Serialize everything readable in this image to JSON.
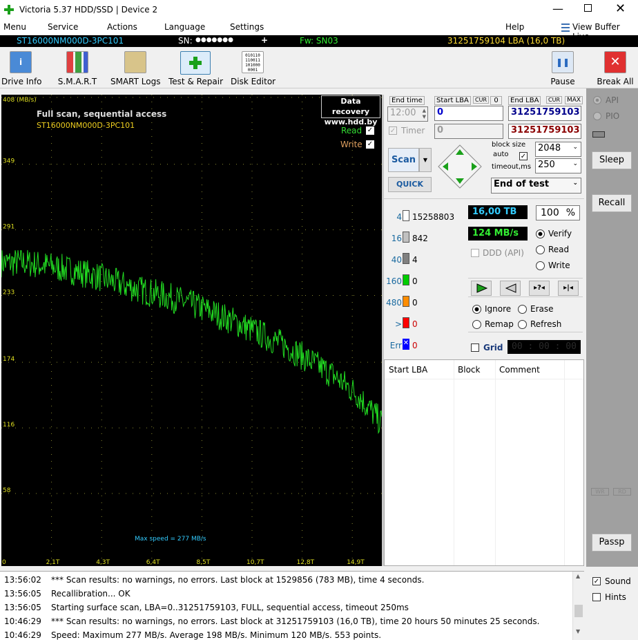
{
  "window": {
    "title": "Victoria 5.37 HDD/SSD | Device 2"
  },
  "menu": [
    "Menu",
    "Service",
    "Actions",
    "Language",
    "Settings",
    "Help"
  ],
  "view_buffer_label": "View Buffer Live",
  "device": {
    "model": "ST16000NM000D-3PC101",
    "sn_label": "SN:",
    "sn": "●●●●●●●",
    "plus": "+",
    "fw": "Fw: SN03",
    "lba": "31251759104 LBA (16,0 TB)"
  },
  "toolbar": {
    "drive_info": "Drive Info",
    "smart": "S.M.A.R.T",
    "smart_logs": "SMART Logs",
    "test_repair": "Test & Repair",
    "disk_editor": "Disk Editor",
    "pause": "Pause",
    "break_all": "Break All"
  },
  "graph": {
    "title": "Full scan, sequential access",
    "subtitle": "ST16000NM000D-3PC101",
    "badge_line1": "Data recovery",
    "badge_line2": "www.hdd.by",
    "read_label": "Read",
    "write_label": "Write",
    "max_speed": "Max speed = 277 MB/s",
    "y_ticks": [
      "408 (MB/s)",
      "349",
      "291",
      "233",
      "174",
      "116",
      "58"
    ],
    "x_ticks": [
      "0",
      "2,1T",
      "4,3T",
      "6,4T",
      "8,5T",
      "10,7T",
      "12,8T",
      "14,9T"
    ]
  },
  "chart_data": {
    "type": "line",
    "title": "Full scan, sequential access",
    "ylabel": "MB/s",
    "ylim": [
      0,
      408
    ],
    "xlim": [
      0,
      16.0
    ],
    "series": [
      {
        "name": "Read",
        "x": [
          0,
          1,
          2,
          3,
          4,
          5,
          6,
          7,
          8,
          9,
          10,
          11,
          12,
          13,
          14,
          15,
          16
        ],
        "values": [
          262,
          262,
          259,
          255,
          250,
          243,
          237,
          232,
          225,
          217,
          208,
          198,
          188,
          175,
          162,
          145,
          120
        ]
      }
    ]
  },
  "controls": {
    "end_time_label": "End time",
    "start_lba_label": "Start LBA",
    "cur": "CUR",
    "zero": "0",
    "end_lba_label": "End LBA",
    "max": "MAX",
    "time_value": "12:00",
    "start_lba": "0",
    "end_lba": "31251759103",
    "timer_label": "Timer",
    "timer_value": "0",
    "end_lba2": "31251759103",
    "scan": "Scan",
    "quick": "QUICK",
    "block_size_label": "block size",
    "auto_label": "auto",
    "timeout_label": "timeout,ms",
    "block_size": "2048",
    "timeout": "250",
    "end_of_test": "End of test"
  },
  "stats": {
    "rows": [
      {
        "label": "4",
        "value": "15258803",
        "color": "#ffffff"
      },
      {
        "label": "16",
        "value": "842",
        "color": "#c0c0c0"
      },
      {
        "label": "40",
        "value": "4",
        "color": "#808080"
      },
      {
        "label": "160",
        "value": "0",
        "color": "#00cc00"
      },
      {
        "label": "480",
        "value": "0",
        "color": "#ff8c00"
      },
      {
        "label": ">",
        "value": "0",
        "color": "#ff0000"
      },
      {
        "label": "Err",
        "value": "0",
        "color": "#0000ff"
      }
    ],
    "size": "16,00 TB",
    "percent": "100",
    "pct_sign": "%",
    "speed": "124 MB/s",
    "ddd": "DDD (API)",
    "verify": "Verify",
    "read": "Read",
    "write": "Write",
    "ignore": "Ignore",
    "erase": "Erase",
    "remap": "Remap",
    "refresh": "Refresh",
    "grid": "Grid",
    "timer_display": "00 : 00 : 00"
  },
  "table": {
    "headers": [
      "Start LBA",
      "Block",
      "Comment"
    ]
  },
  "sidebar": {
    "api": "API",
    "pio": "PIO",
    "sleep": "Sleep",
    "recall": "Recall",
    "wr": "WR",
    "rd": "RD",
    "passp": "Passp"
  },
  "log": [
    {
      "t": "13:56:02",
      "m": "*** Scan results: no warnings, no errors. Last block at 1529856 (783 MB), time 4 seconds."
    },
    {
      "t": "13:56:05",
      "m": "Recallibration... OK"
    },
    {
      "t": "13:56:05",
      "m": "Starting surface scan, LBA=0..31251759103, FULL, sequential access, timeout 250ms"
    },
    {
      "t": "10:46:29",
      "m": "*** Scan results: no warnings, no errors. Last block at 31251759103 (16,0 TB), time 20 hours 50 minutes 25 seconds."
    },
    {
      "t": "10:46:29",
      "m": "Speed: Maximum 277 MB/s. Average 198 MB/s. Minimum 120 MB/s. 553 points."
    }
  ],
  "sound": "Sound",
  "hints": "Hints"
}
